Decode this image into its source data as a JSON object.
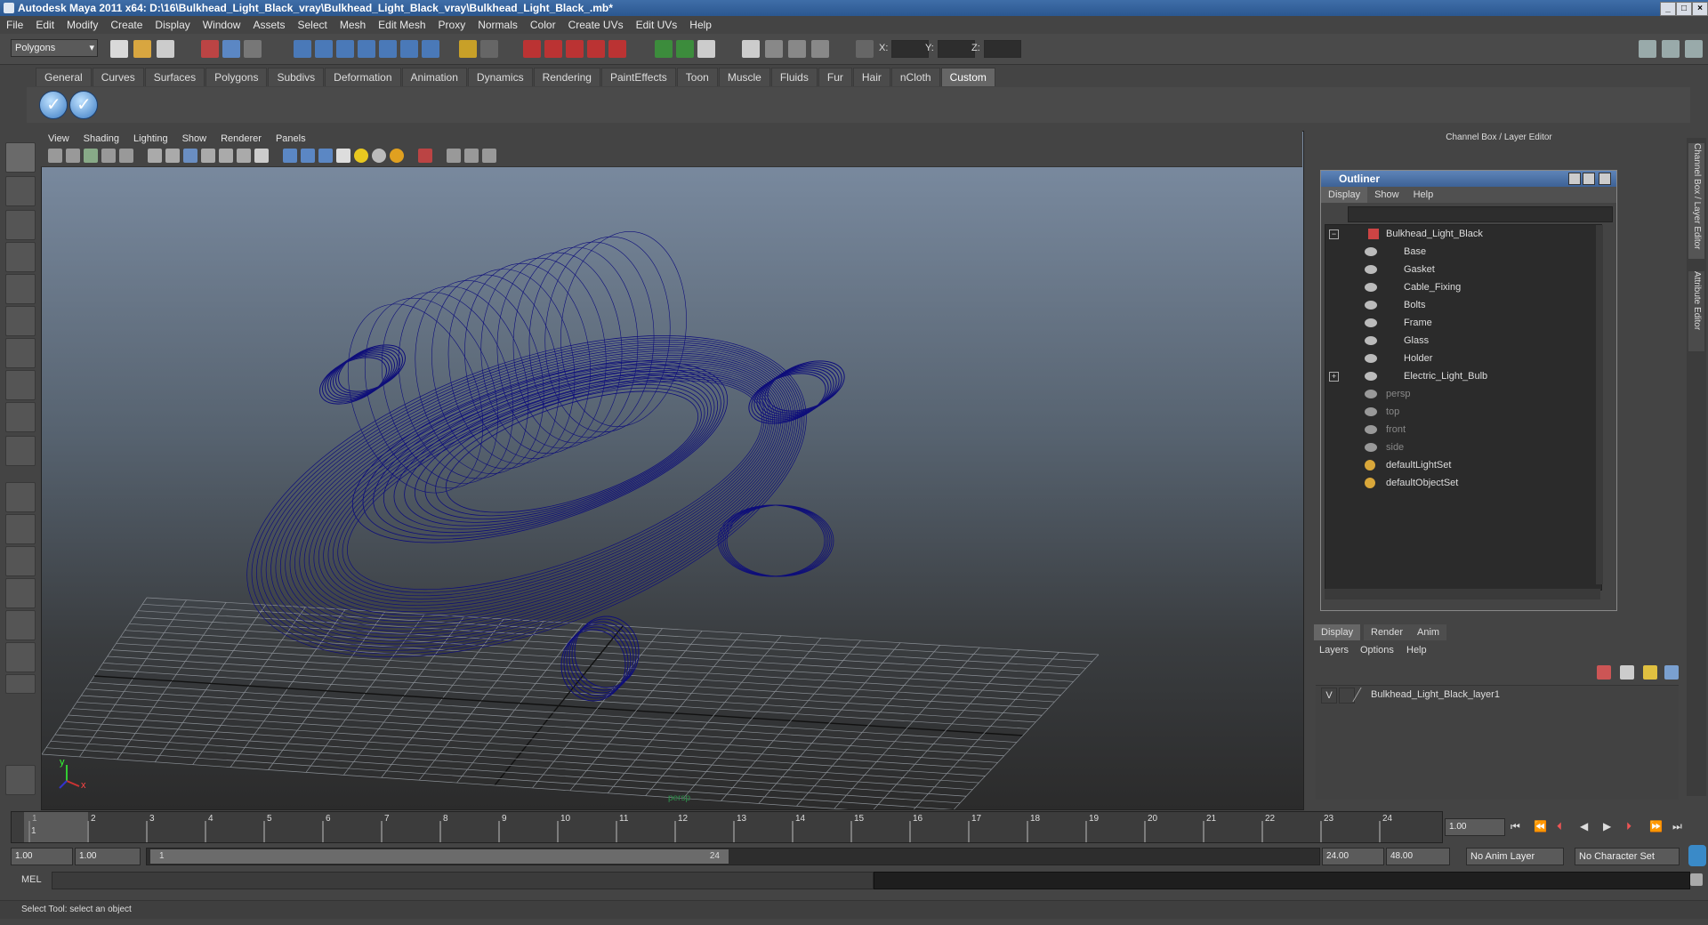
{
  "title": "Autodesk Maya 2011 x64: D:\\16\\Bulkhead_Light_Black_vray\\Bulkhead_Light_Black_vray\\Bulkhead_Light_Black_.mb*",
  "menubar": [
    "File",
    "Edit",
    "Modify",
    "Create",
    "Display",
    "Window",
    "Assets",
    "Select",
    "Mesh",
    "Edit Mesh",
    "Proxy",
    "Normals",
    "Color",
    "Create UVs",
    "Edit UVs",
    "Help"
  ],
  "status": {
    "mode": "Polygons",
    "x_label": "X:",
    "y_label": "Y:",
    "z_label": "Z:"
  },
  "shelf_tabs": [
    "General",
    "Curves",
    "Surfaces",
    "Polygons",
    "Subdivs",
    "Deformation",
    "Animation",
    "Dynamics",
    "Rendering",
    "PaintEffects",
    "Toon",
    "Muscle",
    "Fluids",
    "Fur",
    "Hair",
    "nCloth",
    "Custom"
  ],
  "active_shelf_tab": "Custom",
  "viewport": {
    "menu": [
      "View",
      "Shading",
      "Lighting",
      "Show",
      "Renderer",
      "Panels"
    ],
    "camera_label": "persp",
    "axis_y": "y",
    "axis_x": "x",
    "wire_color": "#0e0e7a"
  },
  "channel_box_title": "Channel Box / Layer Editor",
  "side_tabs": [
    "Channel Box / Layer Editor",
    "Attribute Editor"
  ],
  "outliner": {
    "title": "Outliner",
    "menu": [
      "Display",
      "Show",
      "Help"
    ],
    "items": [
      {
        "label": "Bulkhead_Light_Black",
        "dim": false
      },
      {
        "label": "Base",
        "dim": false
      },
      {
        "label": "Gasket",
        "dim": false
      },
      {
        "label": "Cable_Fixing",
        "dim": false
      },
      {
        "label": "Bolts",
        "dim": false
      },
      {
        "label": "Frame",
        "dim": false
      },
      {
        "label": "Glass",
        "dim": false
      },
      {
        "label": "Holder",
        "dim": false
      },
      {
        "label": "Electric_Light_Bulb",
        "dim": false
      },
      {
        "label": "persp",
        "dim": true
      },
      {
        "label": "top",
        "dim": true
      },
      {
        "label": "front",
        "dim": true
      },
      {
        "label": "side",
        "dim": true
      },
      {
        "label": "defaultLightSet",
        "dim": false
      },
      {
        "label": "defaultObjectSet",
        "dim": false
      }
    ]
  },
  "layer_editor": {
    "tabs": [
      "Display",
      "Render",
      "Anim"
    ],
    "menu": [
      "Layers",
      "Options",
      "Help"
    ],
    "layer_visibility": "V",
    "layer_name": "Bulkhead_Light_Black_layer1"
  },
  "timeline": {
    "ticks": [
      "1",
      "2",
      "3",
      "4",
      "5",
      "6",
      "7",
      "8",
      "9",
      "10",
      "11",
      "12",
      "13",
      "14",
      "15",
      "16",
      "17",
      "18",
      "19",
      "20",
      "21",
      "22",
      "23",
      "24"
    ],
    "current_frame_marker": "1",
    "current_time": "1.00"
  },
  "range": {
    "start": "1.00",
    "playback_start": "1.00",
    "slider_start": "1",
    "slider_end": "24",
    "playback_end": "24.00",
    "end": "48.00",
    "anim_layer": "No Anim Layer",
    "character_set": "No Character Set"
  },
  "command_line": {
    "label": "MEL"
  },
  "help_line": "Select Tool: select an object"
}
